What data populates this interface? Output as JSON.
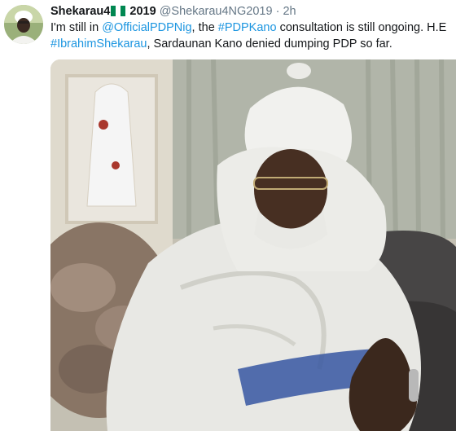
{
  "tweet": {
    "display_name": "Shekarau4",
    "name_suffix": " 2019",
    "handle": "@Shekarau4NG2019",
    "separator": " · ",
    "time": "2h",
    "text_1": "I'm still in ",
    "mention": "@OfficialPDPNig",
    "text_2": ", the ",
    "hashtag_1": "#PDPKano",
    "text_3": " consultation is still ongoing. H.E ",
    "hashtag_2": "#IbrahimShekarau",
    "text_4": ", Sardaunan Kano denied dumping PDP so far."
  },
  "colors": {
    "link": "#1b95e0",
    "name": "#14171a",
    "meta": "#657786",
    "flag_green": "#008751"
  },
  "icons": {
    "flag": "nigeria-flag-icon"
  }
}
